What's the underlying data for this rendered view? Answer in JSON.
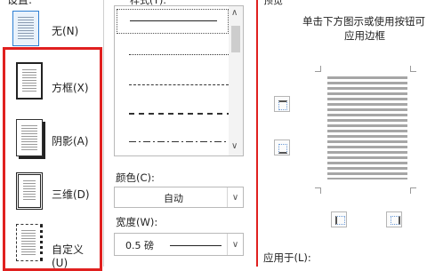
{
  "presets": {
    "heading": "设置:",
    "items": [
      {
        "label": "无(N)"
      },
      {
        "label": "方框(X)"
      },
      {
        "label": "阴影(A)"
      },
      {
        "label": "三维(D)"
      },
      {
        "label": "自定义(U)"
      }
    ]
  },
  "style": {
    "heading": "样式(Y):",
    "lines": [
      "solid",
      "dotted-fine",
      "dashed-fine",
      "dashed",
      "dash-dot"
    ]
  },
  "color": {
    "label": "颜色(C):",
    "value": "自动"
  },
  "width": {
    "label": "宽度(W):",
    "value": "0.5 磅"
  },
  "preview": {
    "heading": "预览",
    "instruction_line1": "单击下方图示或使用按钮可",
    "instruction_line2": "应用边框"
  },
  "apply_to": {
    "label": "应用于(L):"
  },
  "colors": {
    "highlight": "#e0201f",
    "selected_bg": "#dbe9f7",
    "line": "#333333"
  }
}
